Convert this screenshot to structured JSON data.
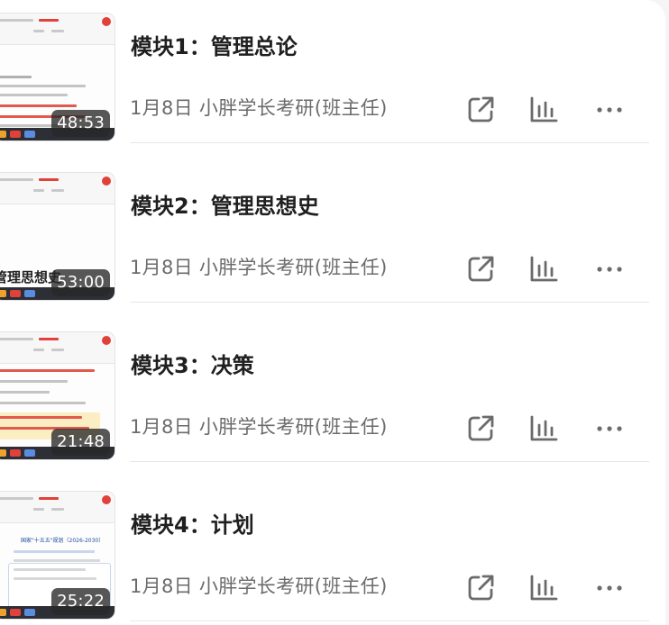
{
  "colors": {
    "title": "#1f1f1f",
    "meta": "#6b6b6b",
    "icon": "#6b6b6b",
    "duration_bg": "#282828",
    "divider": "#e7e7e7"
  },
  "icons": {
    "share": "external-link-icon",
    "stats": "bar-chart-icon",
    "more": "more-dots-icon"
  },
  "lessons": [
    {
      "title": "模块1：管理总论",
      "meta": "1月8日 小胖学长考研(班主任)",
      "duration": "48:53"
    },
    {
      "title": "模块2：管理思想史",
      "meta": "1月8日 小胖学长考研(班主任)",
      "duration": "53:00",
      "thumb_text": "管理思想史"
    },
    {
      "title": "模块3：决策",
      "meta": "1月8日 小胖学长考研(班主任)",
      "duration": "21:48"
    },
    {
      "title": "模块4：计划",
      "meta": "1月8日 小胖学长考研(班主任)",
      "duration": "25:22",
      "thumb_text": "国家\"十五五\"规划（2026-2030）"
    }
  ]
}
